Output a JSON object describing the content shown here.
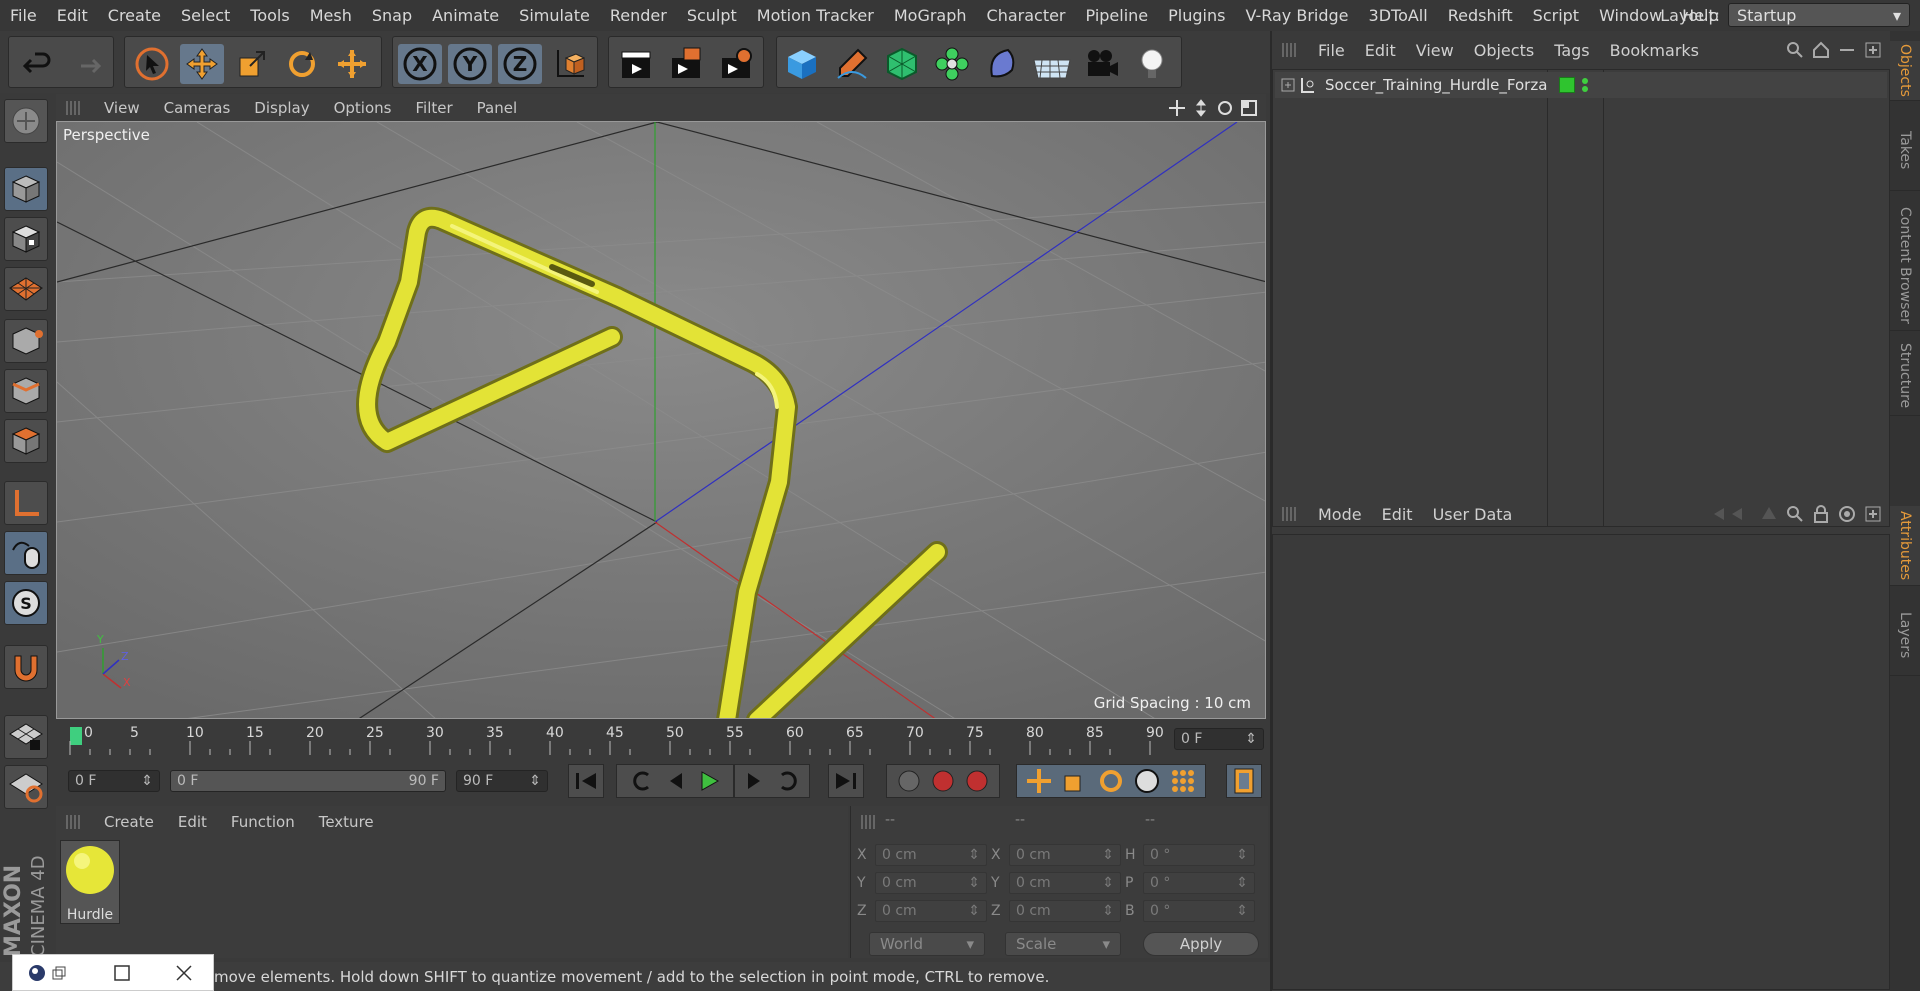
{
  "menubar": {
    "items": [
      "File",
      "Edit",
      "Create",
      "Select",
      "Tools",
      "Mesh",
      "Snap",
      "Animate",
      "Simulate",
      "Render",
      "Sculpt",
      "Motion Tracker",
      "MoGraph",
      "Character",
      "Pipeline",
      "Plugins",
      "V-Ray Bridge",
      "3DToAll",
      "Redshift",
      "Script",
      "Window",
      "Help"
    ],
    "layout_label": "Layout:",
    "layout_value": "Startup"
  },
  "toolbar": {
    "axis_x": "X",
    "axis_y": "Y",
    "axis_z": "Z"
  },
  "viewport": {
    "menu": [
      "View",
      "Cameras",
      "Display",
      "Options",
      "Filter",
      "Panel"
    ],
    "camera_label": "Perspective",
    "grid_spacing": "Grid Spacing : 10 cm",
    "axis_y": "Y",
    "axis_z": "Z",
    "axis_x": "X",
    "colors": {
      "object": "#e3e336",
      "x_axis": "#c03030",
      "y_axis": "#30a030",
      "z_axis": "#3030c0"
    }
  },
  "timeline": {
    "ticks": [
      "0",
      "5",
      "10",
      "15",
      "20",
      "25",
      "30",
      "35",
      "40",
      "45",
      "50",
      "55",
      "60",
      "65",
      "70",
      "75",
      "80",
      "85",
      "90"
    ],
    "current_frame": "0 F"
  },
  "transport": {
    "start_frame": "0 F",
    "range_start": "0 F",
    "range_end": "90 F",
    "end_frame": "90 F"
  },
  "materials": {
    "menu": [
      "Create",
      "Edit",
      "Function",
      "Texture"
    ],
    "items": [
      {
        "name": "Hurdle",
        "color": "#e6e638"
      }
    ]
  },
  "coordinates": {
    "headers": [
      "--",
      "--",
      "--"
    ],
    "rows": [
      {
        "a": "X",
        "av": "0 cm",
        "b": "X",
        "bv": "0 cm",
        "c": "H",
        "cv": "0 °"
      },
      {
        "a": "Y",
        "av": "0 cm",
        "b": "Y",
        "bv": "0 cm",
        "c": "P",
        "cv": "0 °"
      },
      {
        "a": "Z",
        "av": "0 cm",
        "b": "Z",
        "bv": "0 cm",
        "c": "B",
        "cv": "0 °"
      }
    ],
    "space": "World",
    "mode": "Scale",
    "apply": "Apply"
  },
  "status": {
    "text": "move elements. Hold down SHIFT to quantize movement / add to the selection in point mode, CTRL to remove."
  },
  "brand": {
    "maker": "MAXON",
    "product": "CINEMA 4D"
  },
  "object_manager": {
    "menu": [
      "File",
      "Edit",
      "View",
      "Objects",
      "Tags",
      "Bookmarks"
    ],
    "objects": [
      {
        "name": "Soccer_Training_Hurdle_Forza",
        "layer_color": "#2fc42f"
      }
    ]
  },
  "attributes": {
    "menu": [
      "Mode",
      "Edit",
      "User Data"
    ]
  },
  "side_tabs": {
    "top": [
      "Objects",
      "Takes",
      "Content Browser",
      "Structure"
    ],
    "bottom": [
      "Attributes",
      "Layers"
    ]
  }
}
